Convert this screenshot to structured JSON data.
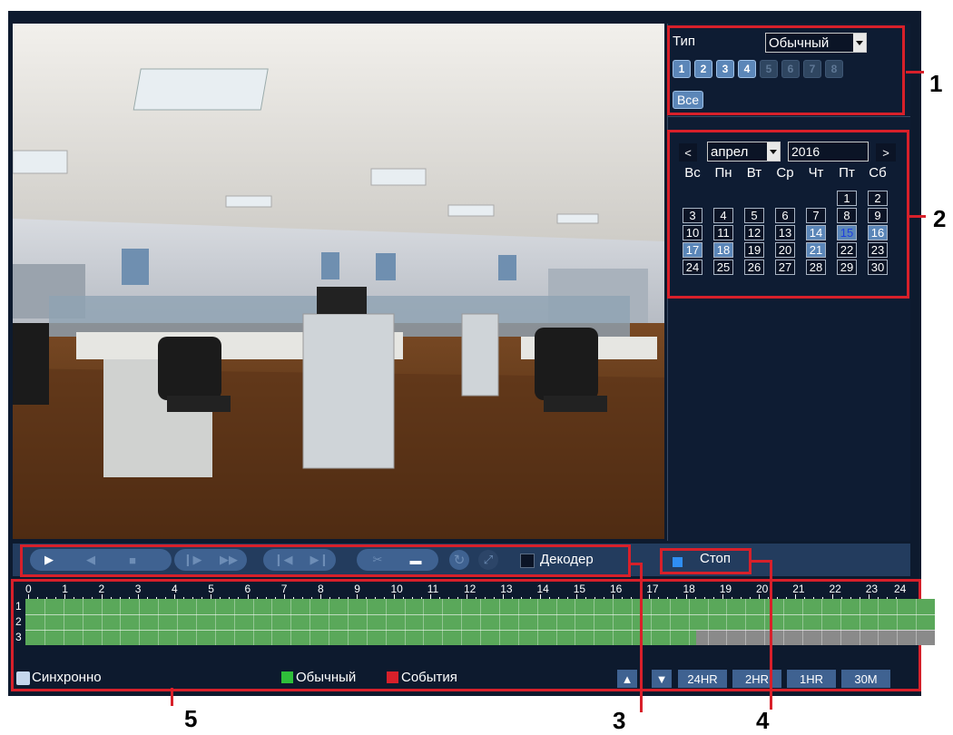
{
  "type_panel": {
    "type_label": "Тип",
    "type_value": "Обычный",
    "channels": [
      {
        "label": "1",
        "enabled": true
      },
      {
        "label": "2",
        "enabled": true
      },
      {
        "label": "3",
        "enabled": true
      },
      {
        "label": "4",
        "enabled": true
      },
      {
        "label": "5",
        "enabled": false
      },
      {
        "label": "6",
        "enabled": false
      },
      {
        "label": "7",
        "enabled": false
      },
      {
        "label": "8",
        "enabled": false
      }
    ],
    "all_label": "Все"
  },
  "calendar": {
    "prev": "<",
    "next": ">",
    "month": "апрел",
    "year": "2016",
    "weekdays": [
      "Вс",
      "Пн",
      "Вт",
      "Ср",
      "Чт",
      "Пт",
      "Сб"
    ],
    "weeks": [
      [
        null,
        null,
        null,
        null,
        null,
        {
          "d": "1"
        },
        {
          "d": "2"
        }
      ],
      [
        {
          "d": "3"
        },
        {
          "d": "4"
        },
        {
          "d": "5"
        },
        {
          "d": "6"
        },
        {
          "d": "7"
        },
        {
          "d": "8"
        },
        {
          "d": "9"
        }
      ],
      [
        {
          "d": "10"
        },
        {
          "d": "11"
        },
        {
          "d": "12"
        },
        {
          "d": "13"
        },
        {
          "d": "14",
          "rec": true
        },
        {
          "d": "15",
          "today": true
        },
        {
          "d": "16",
          "rec": true
        }
      ],
      [
        {
          "d": "17",
          "rec": true
        },
        {
          "d": "18",
          "rec": true
        },
        {
          "d": "19"
        },
        {
          "d": "20"
        },
        {
          "d": "21",
          "rec": true
        },
        {
          "d": "22"
        },
        {
          "d": "23"
        }
      ],
      [
        {
          "d": "24"
        },
        {
          "d": "25"
        },
        {
          "d": "26"
        },
        {
          "d": "27"
        },
        {
          "d": "28"
        },
        {
          "d": "29"
        },
        {
          "d": "30"
        }
      ]
    ]
  },
  "controls": {
    "decoder_label": "Декодер",
    "stop_label": "Стоп"
  },
  "timeline": {
    "hours": [
      "0",
      "1",
      "2",
      "3",
      "4",
      "5",
      "6",
      "7",
      "8",
      "9",
      "10",
      "11",
      "12",
      "13",
      "14",
      "15",
      "16",
      "17",
      "18",
      "19",
      "20",
      "21",
      "22",
      "23",
      "24"
    ],
    "rows": [
      {
        "label": "1",
        "recorded_until_hour": 24
      },
      {
        "label": "2",
        "recorded_until_hour": 24
      },
      {
        "label": "3",
        "recorded_until_hour": 17.7
      }
    ],
    "sync_label": "Синхронно",
    "legend_normal": "Обычный",
    "legend_events": "События",
    "zoom_buttons": [
      "24HR",
      "2HR",
      "1HR",
      "30M"
    ],
    "colors": {
      "normal": "#5aa85a",
      "events": "#d8202a",
      "empty": "#8a8a8a"
    }
  },
  "annotations": [
    "1",
    "2",
    "3",
    "4",
    "5"
  ]
}
